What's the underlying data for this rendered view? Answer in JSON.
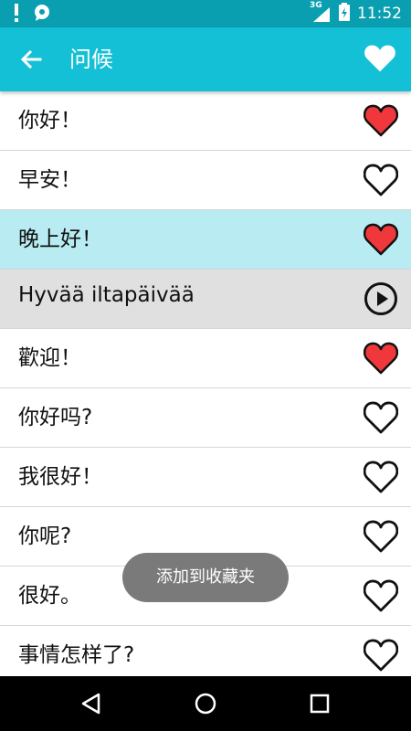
{
  "status_bar": {
    "network": "3G",
    "time": "11:52"
  },
  "app_bar": {
    "title": "问候",
    "back_icon": "arrow-left-icon",
    "favorite_icon": "heart-filled-icon"
  },
  "phrases": [
    {
      "text": "你好！",
      "icon": "heart-filled-icon",
      "favorited": true,
      "state": "normal"
    },
    {
      "text": "早安！",
      "icon": "heart-outline-icon",
      "favorited": false,
      "state": "normal"
    },
    {
      "text": "晚上好！",
      "icon": "heart-filled-icon",
      "favorited": true,
      "state": "active"
    },
    {
      "text": "Hyvää iltapäivää",
      "icon": "play-icon",
      "favorited": false,
      "state": "playing"
    },
    {
      "text": "歡迎！",
      "icon": "heart-filled-icon",
      "favorited": true,
      "state": "normal"
    },
    {
      "text": "你好吗?",
      "icon": "heart-outline-icon",
      "favorited": false,
      "state": "normal"
    },
    {
      "text": "我很好！",
      "icon": "heart-outline-icon",
      "favorited": false,
      "state": "normal"
    },
    {
      "text": "你呢?",
      "icon": "heart-outline-icon",
      "favorited": false,
      "state": "normal"
    },
    {
      "text": "很好。",
      "icon": "heart-outline-icon",
      "favorited": false,
      "state": "normal"
    },
    {
      "text": "事情怎样了?",
      "icon": "heart-outline-icon",
      "favorited": false,
      "state": "normal"
    }
  ],
  "toast": {
    "message": "添加到收藏夹"
  },
  "colors": {
    "status_bar": "#0a9fb0",
    "app_bar": "#14c0d6",
    "heart_fill": "#f0383c",
    "active_row": "#b8ebf2",
    "playing_row": "#e0e0e0"
  }
}
